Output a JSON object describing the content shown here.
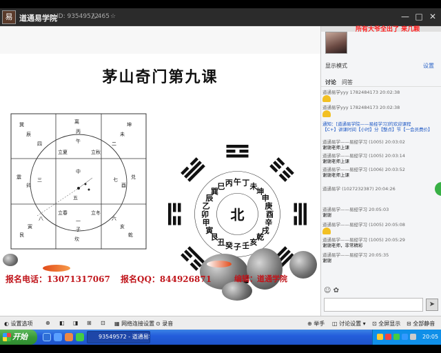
{
  "window": {
    "app_name": "道通易学院",
    "room_id": "ID: 93549572",
    "viewers": "△ 465",
    "favorite_icon": "☆",
    "controls": {
      "minimize": "—",
      "maximize": "□",
      "close": "✕"
    }
  },
  "slide": {
    "title": "茅山奇门第九课",
    "phone": "报名电话：13071317067",
    "qq": "报名QQ：844926871",
    "teacher": "编辑：道通学院",
    "bagua_center": "北",
    "bagua_trigrams": [
      "坎",
      "艮",
      "震",
      "巽",
      "离",
      "坤",
      "兑",
      "乾"
    ],
    "bagua_inner": [
      "子",
      "癸",
      "丑",
      "艮",
      "寅",
      "甲",
      "卯",
      "乙",
      "辰",
      "巽",
      "巳",
      "丙",
      "午",
      "丁",
      "未",
      "坤",
      "申",
      "庚",
      "酉",
      "辛",
      "戌",
      "乾",
      "亥",
      "壬"
    ],
    "grid_cells": [
      "巽",
      "离",
      "坤",
      "震",
      "中",
      "兑",
      "艮",
      "坎",
      "乾"
    ]
  },
  "panel": {
    "announcer": "所有大爷全出了 来几颗",
    "layout_label": "显示模式",
    "layout_button": "设置",
    "tabs": [
      "讨论",
      "问答"
    ],
    "messages": [
      {
        "meta": "道通易学yyy 1782484173 20:02:38",
        "text": ""
      },
      {
        "meta": "道通易学yyy 1782484173 20:02:38",
        "text": ""
      },
      {
        "meta": "通知：[道通易学院——易经学习]的欢迎课程",
        "text": "【C+】讲课时间【小时】分【整点】节【一会员费价】",
        "style": "blue"
      },
      {
        "meta": "道通易学——易经学习 (1005) 20:03:02",
        "text": "谢谢老师上课"
      },
      {
        "meta": "道通易学——易经学习 (1005) 20:03:14",
        "text": "谢谢老师上课"
      },
      {
        "meta": "道通易学——易经学习 (1006) 20:03:52",
        "text": "谢谢老师上课"
      },
      {
        "meta": "道通易学 (1027232387) 20:04:26",
        "text": ""
      },
      {
        "meta": "道通易学——易经学习 20:05:03",
        "text": "谢谢"
      },
      {
        "meta": "道通易学——易经学习 (1005) 20:05:08",
        "text": ""
      },
      {
        "meta": "道通易学——易经学习 (1005) 20:05:29",
        "text": "谢谢老师，非常精彩"
      },
      {
        "meta": "道通易学——易经学习 20:05:35",
        "text": "谢谢"
      }
    ],
    "input_tools": "☺ ✿",
    "send": "➤"
  },
  "toolbar": {
    "left": [
      "◐ 设置选项",
      "⊕",
      "◧",
      "◨",
      "⊞",
      "⊡",
      "▦ 网络连接设置",
      "⊙ 录音"
    ],
    "right": [
      "⊕ 举手",
      "◫ 讨论设置 ▾",
      "⊡ 全屏显示",
      "⊟ 全部静音"
    ]
  },
  "taskbar": {
    "start_label": "开始",
    "task_item": "93549572 - 道通易学院",
    "clock": "20:05"
  },
  "colors": {
    "accent_red": "#c0151b",
    "panel_blue": "#2e66c8",
    "taskbar_blue": "#245edc",
    "start_green": "#3a9b3a"
  }
}
